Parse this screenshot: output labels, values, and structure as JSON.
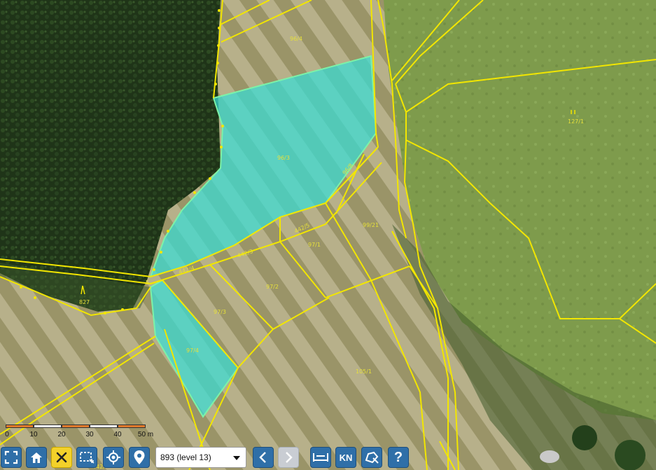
{
  "map": {
    "parcels": [
      {
        "label": "96/4"
      },
      {
        "label": "96/3"
      },
      {
        "label": "96/8"
      },
      {
        "label": "99/21"
      },
      {
        "label": "442/5"
      },
      {
        "label": "97/1"
      },
      {
        "label": "442/3"
      },
      {
        "label": "442/4"
      },
      {
        "label": "97/2"
      },
      {
        "label": "97/3"
      },
      {
        "label": "97/4"
      },
      {
        "label": "105/1"
      },
      {
        "label": "827"
      },
      {
        "label": "127/1"
      },
      {
        "label": "5"
      },
      {
        "label": "442/"
      }
    ],
    "colors": {
      "parcel_line": "#f2e600",
      "selection_fill": "#35e0d8",
      "selection_stroke": "#7df2a8",
      "forest": "#1e3316",
      "meadow": "#a9a070",
      "field": "#7c9a4a"
    }
  },
  "scale": {
    "ticks": [
      "0",
      "10",
      "20",
      "30",
      "40",
      "50 m"
    ]
  },
  "toolbar": {
    "level_value": "893 (level 13)",
    "kn_label": "KN",
    "help_label": "?",
    "icons": {
      "fullscreen": "fullscreen-icon",
      "home": "home-icon",
      "clear": "close-icon",
      "select_area": "select-rectangle-icon",
      "locate": "crosshair-icon",
      "place": "map-pin-icon",
      "prev": "chevron-left-icon",
      "next": "chevron-right-icon",
      "measure": "measure-icon",
      "draw": "draw-shape-icon"
    }
  }
}
